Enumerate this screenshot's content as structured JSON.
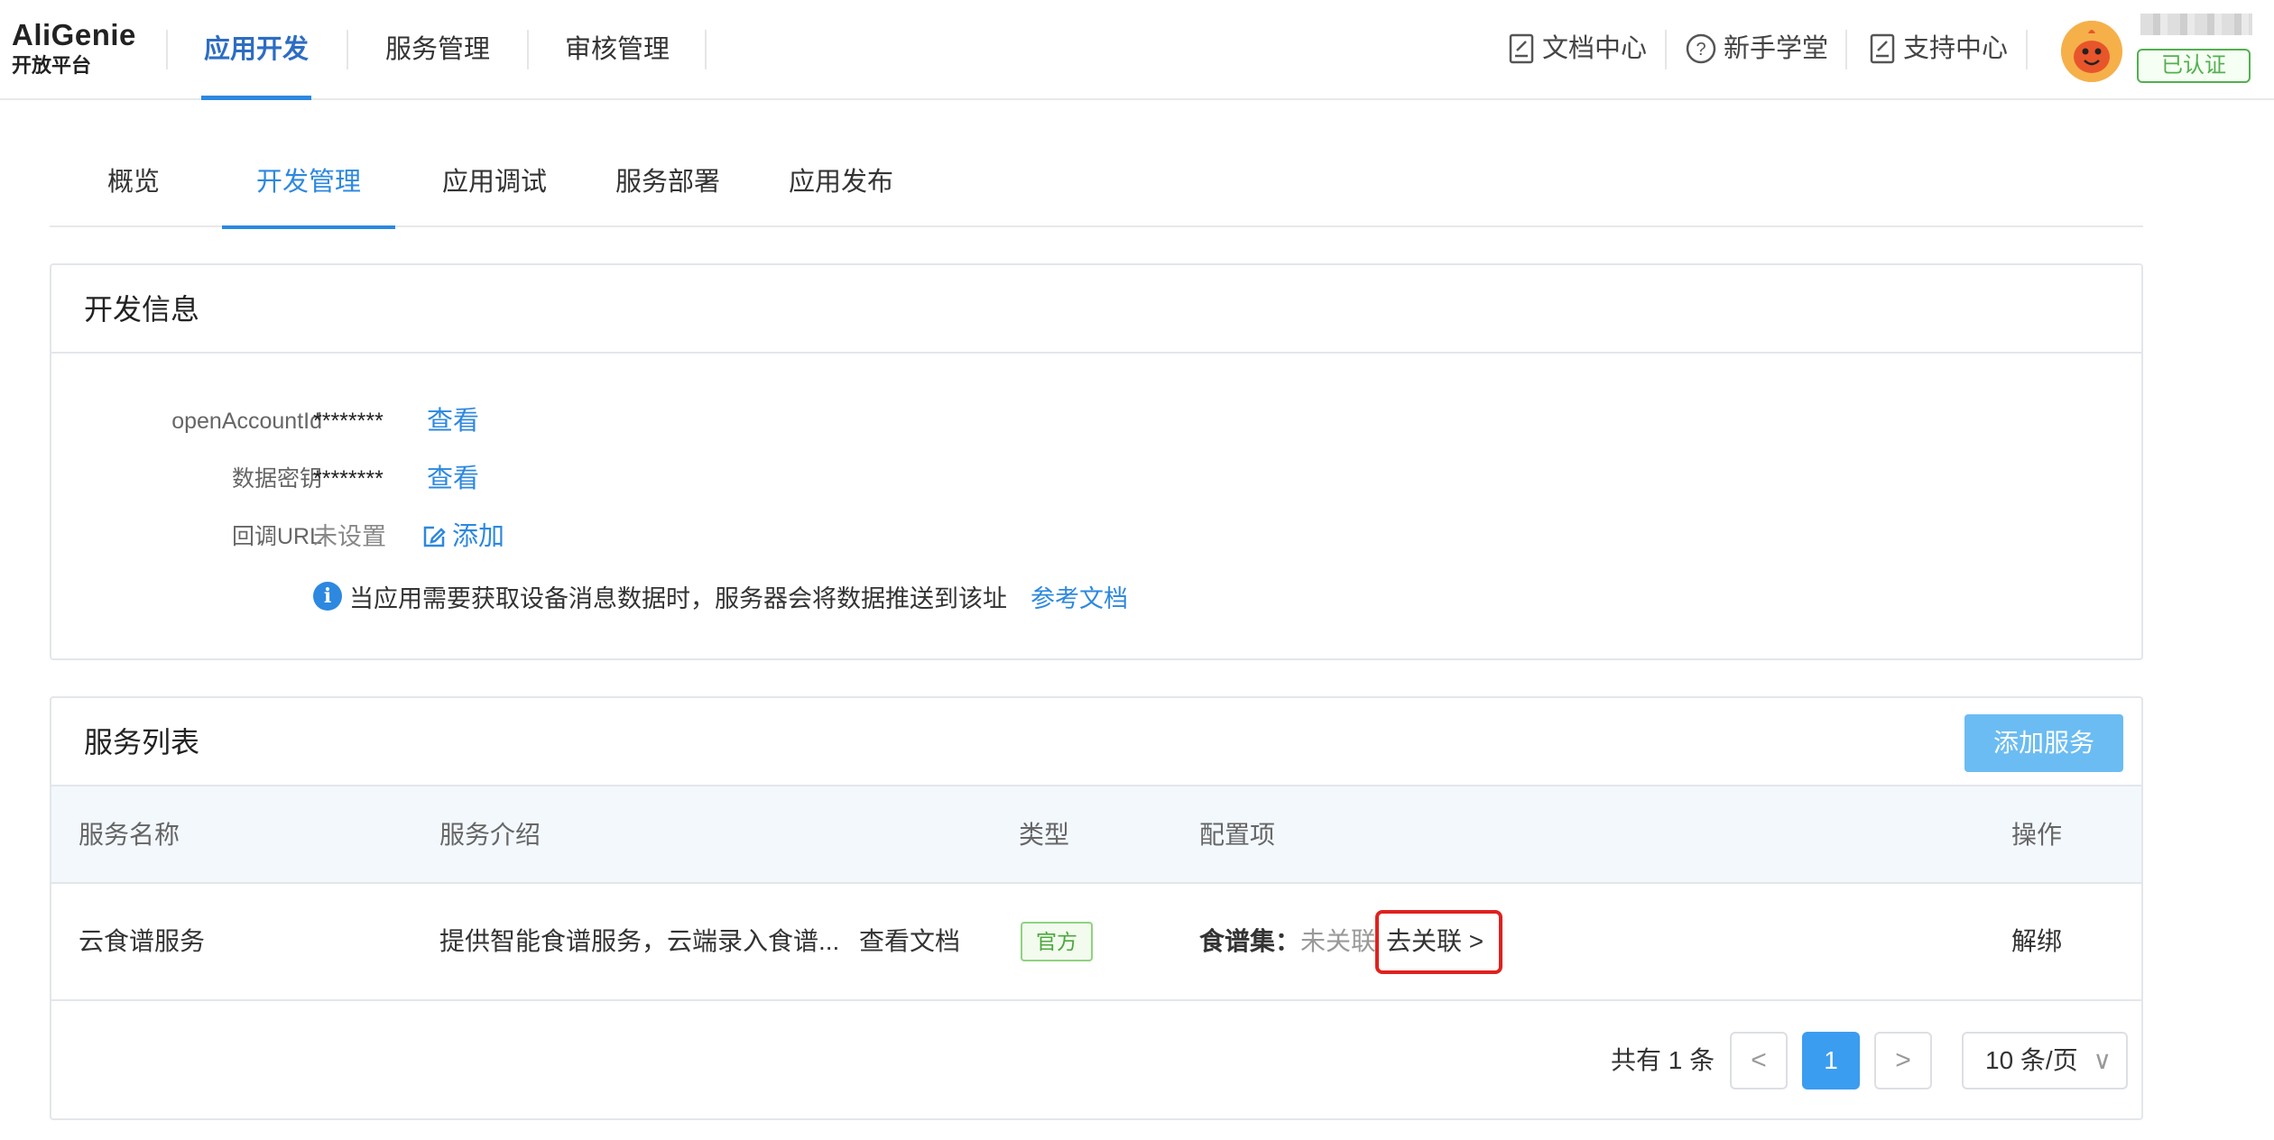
{
  "brand": {
    "name": "AliGenie",
    "subtitle": "开放平台"
  },
  "top_nav": {
    "tabs": [
      {
        "label": "应用开发",
        "active": true
      },
      {
        "label": "服务管理",
        "active": false
      },
      {
        "label": "审核管理",
        "active": false
      }
    ],
    "links": [
      {
        "label": "文档中心",
        "icon": "document-icon"
      },
      {
        "label": "新手学堂",
        "icon": "help-circle-icon"
      },
      {
        "label": "支持中心",
        "icon": "document-icon"
      }
    ],
    "user": {
      "verified_badge": "已认证"
    }
  },
  "sub_tabs": [
    {
      "label": "概览",
      "active": false
    },
    {
      "label": "开发管理",
      "active": true
    },
    {
      "label": "应用调试",
      "active": false
    },
    {
      "label": "服务部署",
      "active": false
    },
    {
      "label": "应用发布",
      "active": false
    }
  ],
  "dev_info": {
    "title": "开发信息",
    "rows": [
      {
        "label": "openAccountId",
        "value": "********",
        "action": "查看"
      },
      {
        "label": "数据密钥",
        "value": "********",
        "action": "查看"
      },
      {
        "label": "回调URL",
        "value": "未设置",
        "action": "添加"
      }
    ],
    "hint": {
      "text": "当应用需要获取设备消息数据时，服务器会将数据推送到该址",
      "link": "参考文档",
      "icon": "info-icon"
    }
  },
  "service_list": {
    "title": "服务列表",
    "add_button": "添加服务",
    "columns": [
      "服务名称",
      "服务介绍",
      "类型",
      "配置项",
      "操作"
    ],
    "rows": [
      {
        "name": "云食谱服务",
        "intro": "提供智能食谱服务，云端录入食谱...",
        "intro_link": "查看文档",
        "type": "官方",
        "config_label": "食谱集：",
        "config_status": "未关联",
        "config_link": "去关联 >",
        "action": "解绑"
      }
    ],
    "pagination": {
      "total_text": "共有 1 条",
      "prev": "<",
      "current_page": "1",
      "next": ">",
      "page_size": "10 条/页"
    }
  },
  "colors": {
    "accent": "#2d88e0",
    "nav_active": "#2d6dc2",
    "verified": "#52b04f",
    "highlight": "#e0211f",
    "add_button": "#6bbcf2"
  }
}
